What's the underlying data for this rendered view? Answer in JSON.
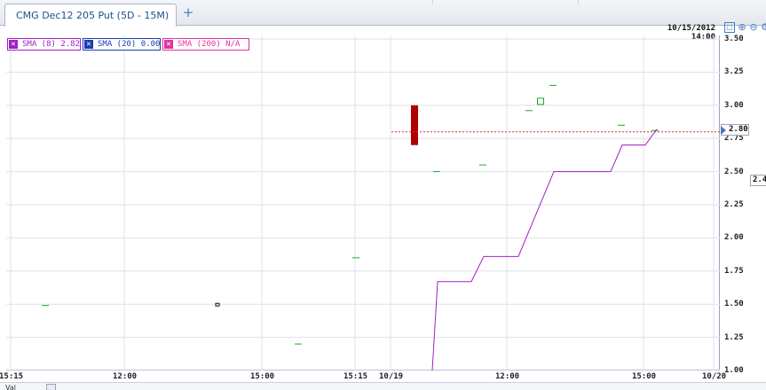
{
  "tab": {
    "title": "CMG Dec12 205 Put (5D - 15M)",
    "add_label": "+"
  },
  "chart": {
    "timestamp": "10/15/2012 14:00",
    "legend": [
      {
        "label": "SMA (8) 2.82",
        "color": "#a020c8"
      },
      {
        "label": "SMA (20) 0.00",
        "color": "#1a3cb0"
      },
      {
        "label": "SMA (200) N/A",
        "color": "#e0359a"
      }
    ],
    "last_price_label": "2.80",
    "side_label": "2.4",
    "colors": {
      "sma8": "#a020c8",
      "price_line": "#d33030",
      "tick": "#1fa81f",
      "candle_down": "#b00000",
      "grid": "#dde3ea"
    },
    "tools": [
      "restore-icon",
      "zoom-in-icon",
      "zoom-out-icon",
      "settings-icon"
    ]
  },
  "chart_data": {
    "type": "line",
    "ylim": [
      1.0,
      3.5
    ],
    "y_ticks": [
      "3.50",
      "3.25",
      "3.00",
      "2.75",
      "2.50",
      "2.25",
      "2.00",
      "1.75",
      "1.50",
      "1.25",
      "1.00"
    ],
    "x_ticks": [
      "15:15",
      "12:00",
      "15:00",
      "15:15",
      "10/19",
      "12:00",
      "15:00",
      "10/20"
    ],
    "price_points": [
      {
        "bar": 0,
        "value": 1.49
      },
      {
        "bar": 1,
        "value": 1.5,
        "style": "hollow"
      },
      {
        "bar": 2,
        "value": 1.2
      },
      {
        "bar": 3,
        "value": 1.85
      },
      {
        "bar": 4,
        "open": 3.0,
        "close": 2.7,
        "style": "candle-down"
      },
      {
        "bar": 5,
        "value": 2.5
      },
      {
        "bar": 6,
        "value": 2.55
      },
      {
        "bar": 7,
        "value": 2.96
      },
      {
        "bar": 8,
        "value": 3.03,
        "style": "hollow"
      },
      {
        "bar": 9,
        "value": 3.15
      },
      {
        "bar": 10,
        "value": 2.85
      },
      {
        "bar": 11,
        "value": 2.81
      }
    ],
    "series": [
      {
        "name": "SMA (8)",
        "points": [
          [
            0,
            1.0
          ],
          [
            1,
            1.67
          ],
          [
            2,
            1.67
          ],
          [
            3,
            1.86
          ],
          [
            4,
            1.86
          ],
          [
            5,
            2.5
          ],
          [
            6,
            2.5
          ],
          [
            7,
            2.7
          ],
          [
            8,
            2.7
          ],
          [
            9,
            2.82
          ]
        ]
      }
    ],
    "last_price": 2.8
  },
  "status": {
    "bottom_text": "Val"
  }
}
